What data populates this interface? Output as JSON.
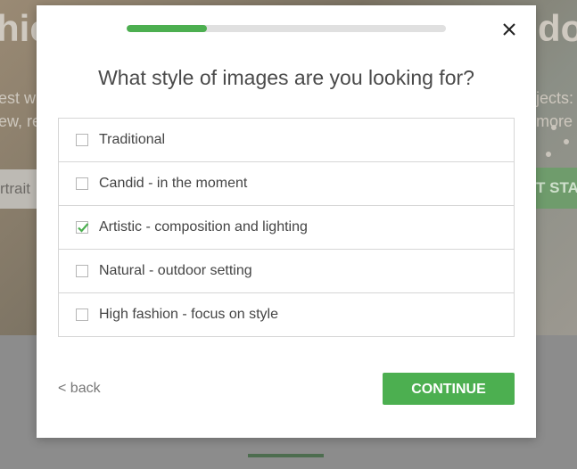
{
  "background": {
    "heading_left": "hie",
    "heading_right": "do",
    "sub_left_1": "est w",
    "sub_left_2": "ew, re",
    "sub_right_1": "jects:",
    "sub_right_2": "more",
    "search_value": "rtrait",
    "start_button": "T STA"
  },
  "modal": {
    "progress_fraction": 0.25,
    "title": "What style of images are you looking for?",
    "options": [
      {
        "label": "Traditional",
        "checked": false
      },
      {
        "label": "Candid - in the moment",
        "checked": false
      },
      {
        "label": "Artistic - composition and lighting",
        "checked": true
      },
      {
        "label": "Natural - outdoor setting",
        "checked": false
      },
      {
        "label": "High fashion - focus on style",
        "checked": false
      }
    ],
    "back_label": "< back",
    "continue_label": "CONTINUE"
  },
  "colors": {
    "accent": "#4caf50",
    "progress_track": "#e0e0e0"
  }
}
